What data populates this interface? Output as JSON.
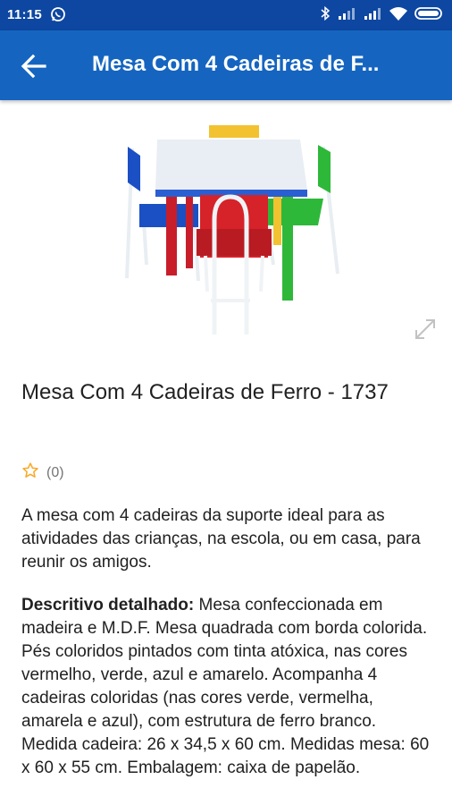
{
  "status_bar": {
    "time": "11:15"
  },
  "app_bar": {
    "title": "Mesa Com 4 Cadeiras de F..."
  },
  "product": {
    "name": "Mesa Com 4 Cadeiras de Ferro - 1737",
    "rating_count": "(0)",
    "description": "A mesa com 4 cadeiras da suporte ideal para as atividades das crianças, na escola, ou em casa, para reunir os amigos.",
    "detail_heading": "Descritivo detalhado:",
    "detail_text": " Mesa confeccionada em madeira e M.D.F. Mesa quadrada com borda colorida. Pés coloridos pintados com tinta  atóxica, nas cores vermelho, verde, azul e amarelo. Acompanha 4 cadeiras coloridas (nas cores verde, vermelha, amarela e azul), com estrutura de ferro branco. Medida cadeira: 26 x 34,5 x 60 cm. Medidas mesa: 60 x 60 x 55 cm. Embalagem: caixa de papelão."
  },
  "icons": {
    "back": "arrow-back-icon",
    "expand": "expand-icon",
    "star": "star-outline-icon",
    "whatsapp": "whatsapp-icon",
    "bluetooth": "bluetooth-icon",
    "signal": "signal-icon",
    "wifi": "wifi-icon",
    "battery": "battery-icon"
  },
  "colors": {
    "status_bar": "#0d47a1",
    "app_bar": "#1565c0",
    "star": "#f9a825"
  }
}
